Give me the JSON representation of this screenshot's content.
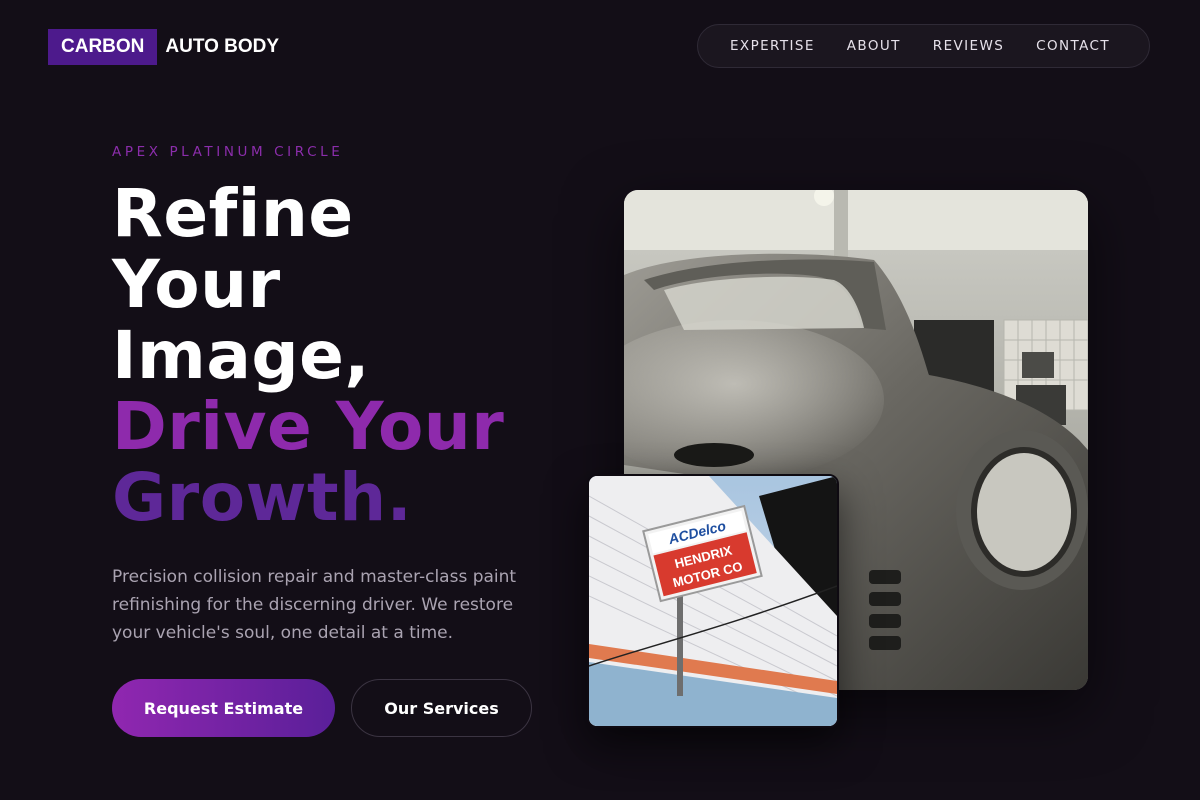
{
  "header": {
    "logo_badge": "CARBON",
    "logo_text": "AUTO BODY"
  },
  "nav": {
    "items": [
      "EXPERTISE",
      "ABOUT",
      "REVIEWS",
      "CONTACT"
    ]
  },
  "hero": {
    "eyebrow": "APEX PLATINUM CIRCLE",
    "headline_lines": [
      "Refine",
      "Your",
      "Image,"
    ],
    "headline_accent_lines": [
      "Drive Your",
      "Growth."
    ],
    "description": "Precision collision repair and master-class paint refinishing for the discerning driver. We restore your vehicle's soul, one detail at a time.",
    "primary_cta": "Request Estimate",
    "secondary_cta": "Our Services"
  },
  "images": {
    "sign_line_1": "ACDelco",
    "sign_line_2": "HENDRIX",
    "sign_line_3": "MOTOR CO"
  },
  "colors": {
    "background": "#130e17",
    "accent_purple": "#8e2aac",
    "accent_violet": "#5e2898",
    "logo_badge": "#4d1a8c"
  }
}
